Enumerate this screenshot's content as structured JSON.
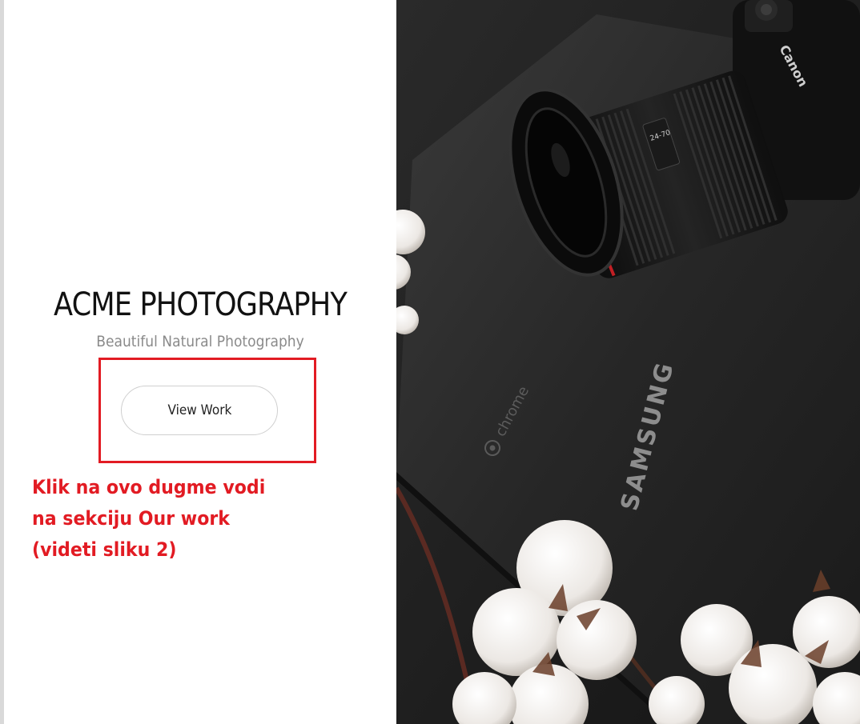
{
  "hero": {
    "title": "ACME PHOTOGRAPHY",
    "subtitle": "Beautiful Natural Photography",
    "cta_label": "View Work"
  },
  "annotation": {
    "lines": [
      "Klik na ovo dugme vodi",
      "na sekciju Our work",
      "(videti sliku 2)"
    ],
    "color": "#e21b23"
  },
  "photo": {
    "camera_brand": "Canon",
    "lens_text": "24-70",
    "laptop_brand": "SAMSUNG",
    "laptop_os": "chrome"
  },
  "colors": {
    "accent_red": "#e21b23",
    "title": "#111111",
    "subtitle": "#8a8a8a"
  }
}
